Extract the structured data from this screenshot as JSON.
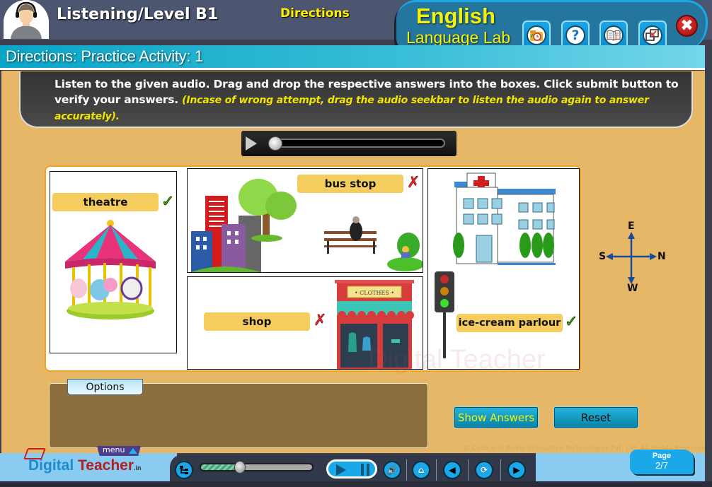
{
  "header": {
    "module_title": "Listening/Level B1",
    "section_title": "Directions",
    "brand_line1": "English",
    "brand_line2": "Language Lab",
    "tools": [
      {
        "name": "history-icon",
        "glyph": "⏰"
      },
      {
        "name": "help-icon",
        "glyph": "?"
      },
      {
        "name": "book-icon",
        "glyph": "📖"
      },
      {
        "name": "window-resize-icon",
        "glyph": "⧉"
      }
    ],
    "close_glyph": "✖"
  },
  "directions_bar": {
    "title": "Directions: Practice Activity: 1"
  },
  "instructions": {
    "main": "Listen to the given audio. Drag and drop the respective answers into the boxes. Click submit button to verify your answers. ",
    "note": "(Incase of wrong attempt, drag the audio seekbar to listen the audio again to answer accurately)."
  },
  "audio_player": {
    "progress_percent": 0
  },
  "cards": [
    {
      "id": "carousel",
      "answer": "theatre",
      "result": "correct",
      "mark": "✓"
    },
    {
      "id": "city-park",
      "answer": "bus stop",
      "result": "wrong",
      "mark": "✗"
    },
    {
      "id": "clothes-shop",
      "answer": "shop",
      "result": "wrong",
      "mark": "✗",
      "sign_text": "• CLOTHES •"
    },
    {
      "id": "hospital-traffic",
      "answer": "ice-cream parlour",
      "result": "correct",
      "mark": "✓"
    }
  ],
  "compass": {
    "top": "E",
    "bottom": "W",
    "left": "S",
    "right": "N"
  },
  "options_panel": {
    "tab_label": "Options"
  },
  "buttons": {
    "show_answers": "Show Answers",
    "reset": "Reset"
  },
  "colors": {
    "show_answers_text": "#f5f20a",
    "reset_text": "#111111",
    "correct": "#46b808",
    "wrong": "#d92a2a"
  },
  "watermark": "Digital Teacher",
  "copyright": "© Code and Pixels Interactive Technologies  Pvt. Ltd. All Rights Reserved.",
  "footer": {
    "logo_part1": "Digital",
    "logo_part2": "Teacher",
    "logo_suffix": ".in",
    "menu_label": "menu",
    "course_progress_percent": 35,
    "page_label": "Page",
    "page_value": "2/7"
  }
}
